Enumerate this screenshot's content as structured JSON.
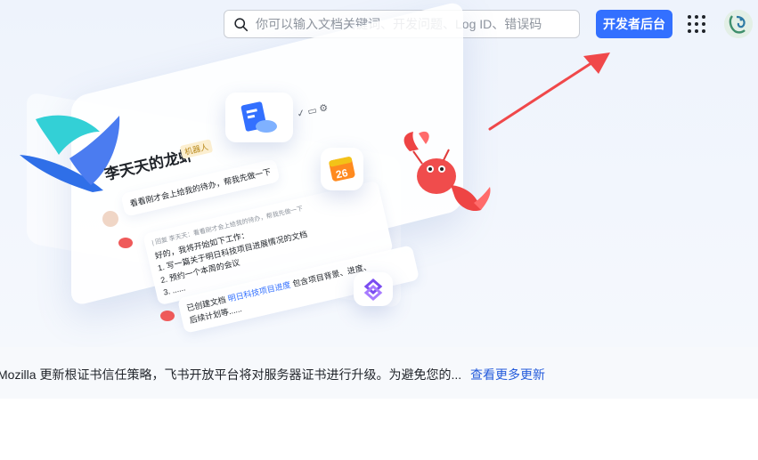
{
  "header": {
    "search_placeholder": "你可以输入文档关键词、开发问题、Log ID、错误码",
    "dev_console_label": "开发者后台",
    "apps_icon": "grid-icon",
    "avatar_icon": "user-avatar"
  },
  "illustration": {
    "assistant_name": "李天天的龙虾",
    "robot_badge": "机器人",
    "user_message": "看看刚才会上给我的待办，帮我先做一下",
    "reply_quote": "| 回复 李天天：看看刚才会上给我的待办，帮我先做一下",
    "reply_lines": [
      "好的，我将开始如下工作：",
      "1. 写一篇关于明日科技项目进展情况的文档",
      "2. 预约一个本周的会议",
      "3. ......"
    ],
    "done_prefix": "已创建文档",
    "done_doc": "明日科技项目进度",
    "done_suffix": "包含项目背景、进度、",
    "done_line2": "后续计划等......",
    "calendar_day": "26"
  },
  "updates": {
    "notice": "Mozilla 更新根证书信任策略，飞书开放平台将对服务器证书进行升级。为避免您的...",
    "more_link": "查看更多更新"
  },
  "colors": {
    "primary": "#3370ff",
    "link": "#245bdb",
    "arrow": "#f0484a"
  }
}
